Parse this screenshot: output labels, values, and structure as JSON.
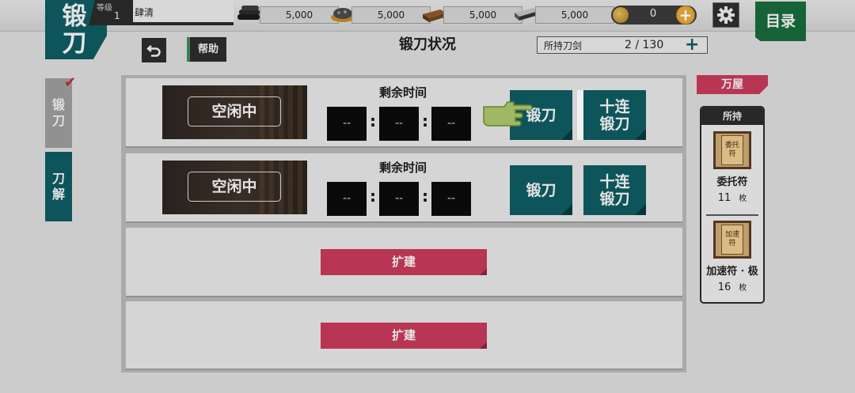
{
  "header": {
    "title": "锻刀",
    "level_label": "等级",
    "level": "1",
    "player_name": "肆清",
    "exp_fraction": 0.05
  },
  "resources": [
    {
      "icon": "charcoal-icon",
      "value": "5,000"
    },
    {
      "icon": "tamahagane-icon",
      "value": "5,000"
    },
    {
      "icon": "cooling-material-icon",
      "value": "5,000"
    },
    {
      "icon": "whetstone-icon",
      "value": "5,000"
    }
  ],
  "coins": {
    "value": "0"
  },
  "menu": {
    "label": "目录"
  },
  "subheader": {
    "help_label": "帮助",
    "title": "锻刀状况",
    "owned_label": "所持刀剑",
    "owned_value": "2 / 130"
  },
  "side_tabs": {
    "forge": "锻刀",
    "dismantle": "刀解"
  },
  "slots": [
    {
      "status": "空闲中",
      "remaining_label": "剩余时间",
      "timer": [
        "--",
        "--",
        "--"
      ],
      "forge_label": "锻刀",
      "forge_ten_label": "十连锻刀"
    },
    {
      "status": "空闲中",
      "remaining_label": "剩余时间",
      "timer": [
        "--",
        "--",
        "--"
      ],
      "forge_label": "锻刀",
      "forge_ten_label": "十连锻刀"
    }
  ],
  "expand_slots": [
    {
      "label": "扩建"
    },
    {
      "label": "扩建"
    }
  ],
  "shop": {
    "label": "万屋"
  },
  "inventory": {
    "header": "所持",
    "items": [
      {
        "token_text": "委托符",
        "name": "委托符",
        "count": "11",
        "unit": "枚"
      },
      {
        "token_text": "加速符",
        "name": "加速符 · 极",
        "count": "16",
        "unit": "枚"
      }
    ]
  },
  "colors": {
    "teal": "#0e5b61",
    "crimson": "#c43a59",
    "menu_green": "#176a3a",
    "background": "#d9d9d9"
  }
}
